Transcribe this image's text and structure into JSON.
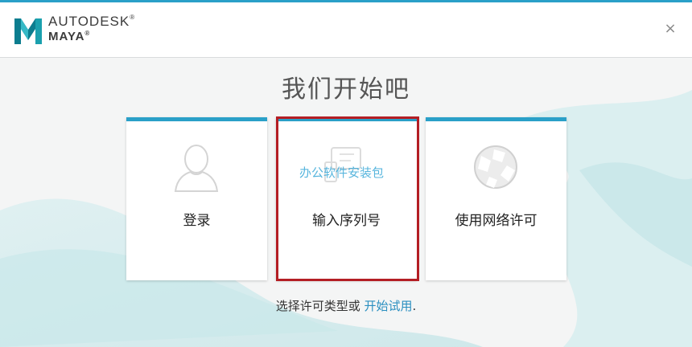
{
  "app": {
    "brand_line1": "AUTODESK",
    "brand_line2": "MAYA",
    "registered_mark": "®",
    "close_symbol": "×"
  },
  "main": {
    "title": "我们开始吧",
    "cards": [
      {
        "label": "登录",
        "icon": "user-silhouette-icon"
      },
      {
        "label": "输入序列号",
        "icon": "serial-number-icon"
      },
      {
        "label": "使用网络许可",
        "icon": "network-globe-icon"
      }
    ],
    "watermark": "办公软件安装包"
  },
  "footer": {
    "text": "选择许可类型或",
    "link": "开始试用",
    "suffix": "."
  },
  "colors": {
    "accent": "#2aa0c8",
    "highlight_border": "#b41e24",
    "link": "#2a8fc0"
  }
}
